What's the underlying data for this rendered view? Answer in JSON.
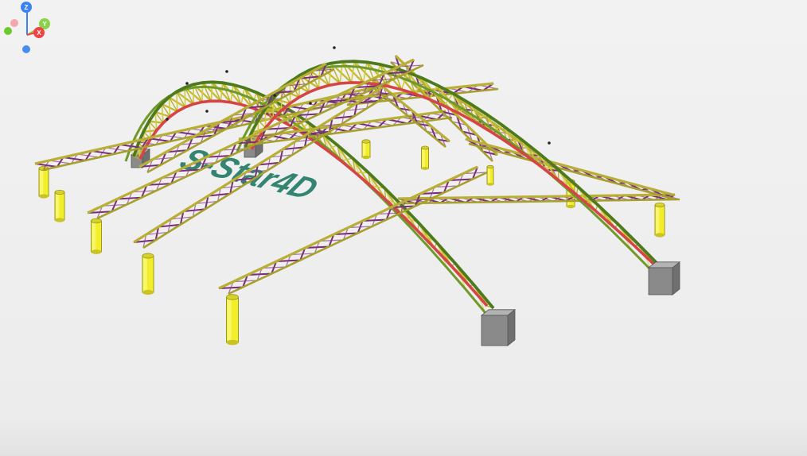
{
  "viewer": {
    "watermark_text": "S-Star4D",
    "background_color": "#efefef"
  },
  "colors": {
    "arch_upper": "#4e7a1e",
    "arch_lower": "#d64545",
    "truss_diagonal": "#c3b92a",
    "chord_yellow": "#b8b034",
    "lattice_purple": "#7a2d7a",
    "column": "#f2ef2a",
    "support_block": "#8a8a8a",
    "watermark": "#1f7a65"
  },
  "axis_triad": {
    "z_label": "Z",
    "y_label": "Y",
    "x_label": "X",
    "z_color": "#3b82f6",
    "y_color": "#8bd24a",
    "x_color": "#ef4444",
    "neg_x_color": "#f4a7ad",
    "neg_y_color": "#6acb2f",
    "neg_z_color": "#4a8df0"
  }
}
